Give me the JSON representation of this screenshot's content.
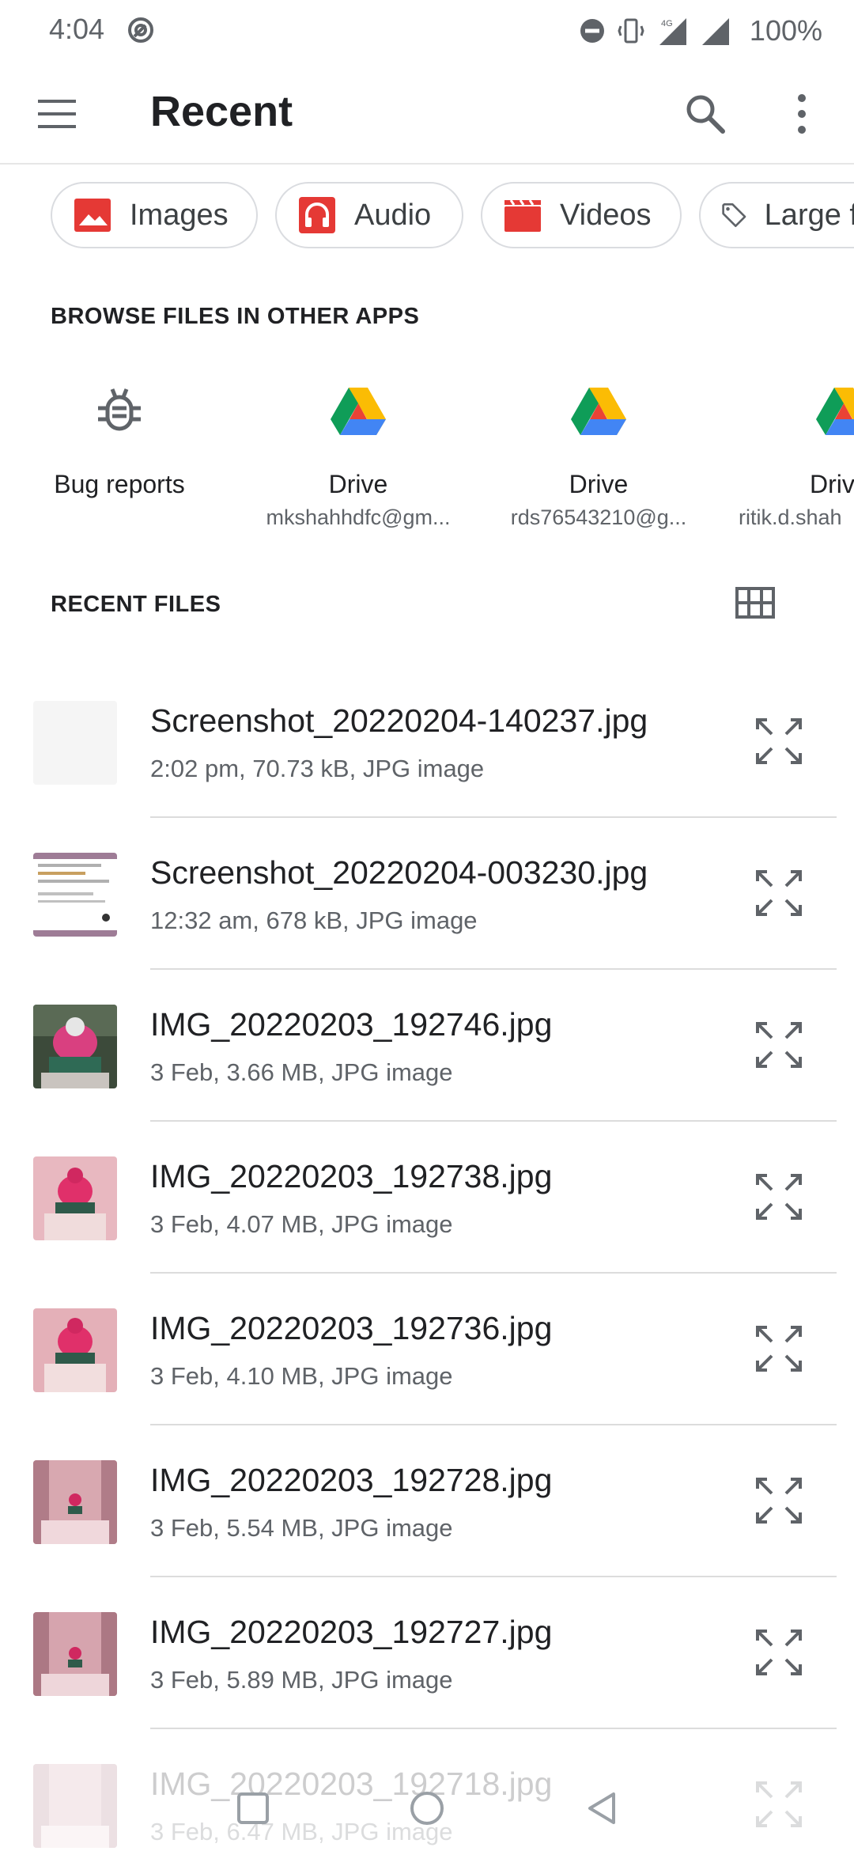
{
  "status_bar": {
    "time": "4:04",
    "battery": "100%"
  },
  "app_bar": {
    "title": "Recent"
  },
  "chips": [
    {
      "label": "Images",
      "icon": "image-icon",
      "color": "#e53935"
    },
    {
      "label": "Audio",
      "icon": "headphones-icon",
      "color": "#e53935"
    },
    {
      "label": "Videos",
      "icon": "video-clapper-icon",
      "color": "#e53935"
    },
    {
      "label": "Large files",
      "icon": "tag-icon",
      "color": "#5f6368"
    }
  ],
  "browse": {
    "title": "BROWSE FILES IN OTHER APPS",
    "apps": [
      {
        "name": "Bug reports",
        "sub": "",
        "icon": "bug-icon"
      },
      {
        "name": "Drive",
        "sub": "mkshahhdfc@gm...",
        "icon": "google-drive-icon"
      },
      {
        "name": "Drive",
        "sub": "rds76543210@g...",
        "icon": "google-drive-icon"
      },
      {
        "name": "Drive",
        "sub": "ritik.d.shah",
        "icon": "google-drive-icon"
      }
    ]
  },
  "recent": {
    "title": "RECENT FILES",
    "files": [
      {
        "name": "Screenshot_20220204-140237.jpg",
        "meta": "2:02 pm, 70.73 kB, JPG image"
      },
      {
        "name": "Screenshot_20220204-003230.jpg",
        "meta": "12:32 am, 678 kB, JPG image"
      },
      {
        "name": "IMG_20220203_192746.jpg",
        "meta": "3 Feb, 3.66 MB, JPG image"
      },
      {
        "name": "IMG_20220203_192738.jpg",
        "meta": "3 Feb, 4.07 MB, JPG image"
      },
      {
        "name": "IMG_20220203_192736.jpg",
        "meta": "3 Feb, 4.10 MB, JPG image"
      },
      {
        "name": "IMG_20220203_192728.jpg",
        "meta": "3 Feb, 5.54 MB, JPG image"
      },
      {
        "name": "IMG_20220203_192727.jpg",
        "meta": "3 Feb, 5.89 MB, JPG image"
      },
      {
        "name": "IMG_20220203_192718.jpg",
        "meta": "3 Feb, 6.47 MB, JPG image"
      }
    ]
  }
}
